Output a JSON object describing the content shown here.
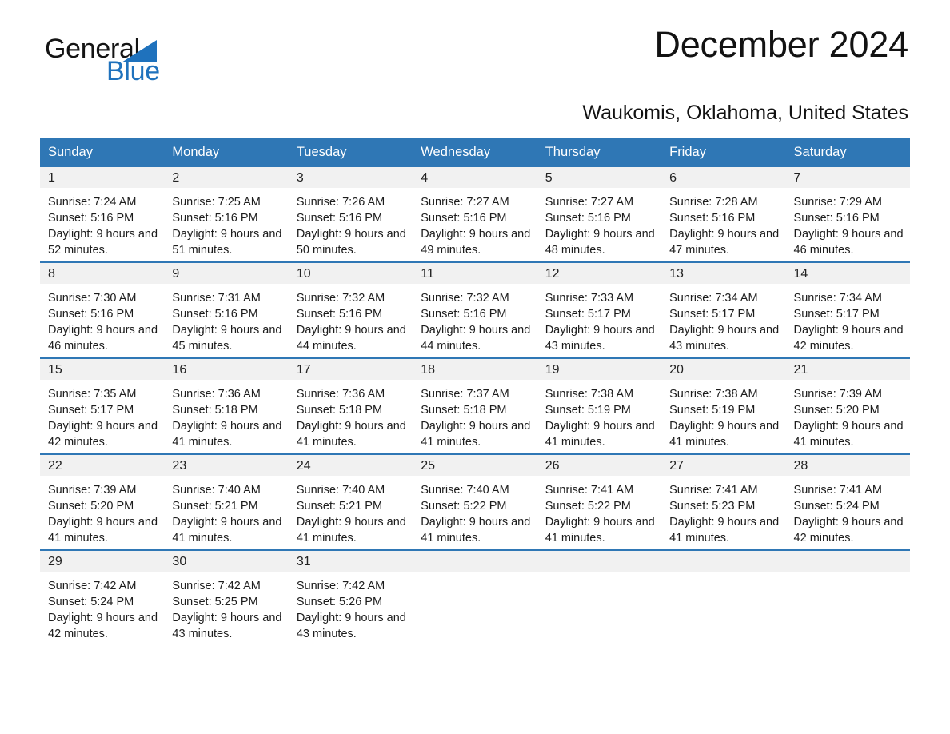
{
  "brand": {
    "word1": "General",
    "word2": "Blue",
    "triangle_color": "#1f72bd",
    "text_color": "#141414"
  },
  "header": {
    "month_title": "December 2024",
    "location": "Waukomis, Oklahoma, United States",
    "header_bg": "#2f77b5",
    "header_text_color": "#ffffff"
  },
  "weekday_headers": [
    "Sunday",
    "Monday",
    "Tuesday",
    "Wednesday",
    "Thursday",
    "Friday",
    "Saturday"
  ],
  "labels": {
    "sunrise_prefix": "Sunrise:",
    "sunset_prefix": "Sunset:",
    "daylight_prefix": "Daylight:"
  },
  "weeks": [
    [
      {
        "day": "1",
        "sunrise": "Sunrise: 7:24 AM",
        "sunset": "Sunset: 5:16 PM",
        "daylight": "Daylight: 9 hours and 52 minutes."
      },
      {
        "day": "2",
        "sunrise": "Sunrise: 7:25 AM",
        "sunset": "Sunset: 5:16 PM",
        "daylight": "Daylight: 9 hours and 51 minutes."
      },
      {
        "day": "3",
        "sunrise": "Sunrise: 7:26 AM",
        "sunset": "Sunset: 5:16 PM",
        "daylight": "Daylight: 9 hours and 50 minutes."
      },
      {
        "day": "4",
        "sunrise": "Sunrise: 7:27 AM",
        "sunset": "Sunset: 5:16 PM",
        "daylight": "Daylight: 9 hours and 49 minutes."
      },
      {
        "day": "5",
        "sunrise": "Sunrise: 7:27 AM",
        "sunset": "Sunset: 5:16 PM",
        "daylight": "Daylight: 9 hours and 48 minutes."
      },
      {
        "day": "6",
        "sunrise": "Sunrise: 7:28 AM",
        "sunset": "Sunset: 5:16 PM",
        "daylight": "Daylight: 9 hours and 47 minutes."
      },
      {
        "day": "7",
        "sunrise": "Sunrise: 7:29 AM",
        "sunset": "Sunset: 5:16 PM",
        "daylight": "Daylight: 9 hours and 46 minutes."
      }
    ],
    [
      {
        "day": "8",
        "sunrise": "Sunrise: 7:30 AM",
        "sunset": "Sunset: 5:16 PM",
        "daylight": "Daylight: 9 hours and 46 minutes."
      },
      {
        "day": "9",
        "sunrise": "Sunrise: 7:31 AM",
        "sunset": "Sunset: 5:16 PM",
        "daylight": "Daylight: 9 hours and 45 minutes."
      },
      {
        "day": "10",
        "sunrise": "Sunrise: 7:32 AM",
        "sunset": "Sunset: 5:16 PM",
        "daylight": "Daylight: 9 hours and 44 minutes."
      },
      {
        "day": "11",
        "sunrise": "Sunrise: 7:32 AM",
        "sunset": "Sunset: 5:16 PM",
        "daylight": "Daylight: 9 hours and 44 minutes."
      },
      {
        "day": "12",
        "sunrise": "Sunrise: 7:33 AM",
        "sunset": "Sunset: 5:17 PM",
        "daylight": "Daylight: 9 hours and 43 minutes."
      },
      {
        "day": "13",
        "sunrise": "Sunrise: 7:34 AM",
        "sunset": "Sunset: 5:17 PM",
        "daylight": "Daylight: 9 hours and 43 minutes."
      },
      {
        "day": "14",
        "sunrise": "Sunrise: 7:34 AM",
        "sunset": "Sunset: 5:17 PM",
        "daylight": "Daylight: 9 hours and 42 minutes."
      }
    ],
    [
      {
        "day": "15",
        "sunrise": "Sunrise: 7:35 AM",
        "sunset": "Sunset: 5:17 PM",
        "daylight": "Daylight: 9 hours and 42 minutes."
      },
      {
        "day": "16",
        "sunrise": "Sunrise: 7:36 AM",
        "sunset": "Sunset: 5:18 PM",
        "daylight": "Daylight: 9 hours and 41 minutes."
      },
      {
        "day": "17",
        "sunrise": "Sunrise: 7:36 AM",
        "sunset": "Sunset: 5:18 PM",
        "daylight": "Daylight: 9 hours and 41 minutes."
      },
      {
        "day": "18",
        "sunrise": "Sunrise: 7:37 AM",
        "sunset": "Sunset: 5:18 PM",
        "daylight": "Daylight: 9 hours and 41 minutes."
      },
      {
        "day": "19",
        "sunrise": "Sunrise: 7:38 AM",
        "sunset": "Sunset: 5:19 PM",
        "daylight": "Daylight: 9 hours and 41 minutes."
      },
      {
        "day": "20",
        "sunrise": "Sunrise: 7:38 AM",
        "sunset": "Sunset: 5:19 PM",
        "daylight": "Daylight: 9 hours and 41 minutes."
      },
      {
        "day": "21",
        "sunrise": "Sunrise: 7:39 AM",
        "sunset": "Sunset: 5:20 PM",
        "daylight": "Daylight: 9 hours and 41 minutes."
      }
    ],
    [
      {
        "day": "22",
        "sunrise": "Sunrise: 7:39 AM",
        "sunset": "Sunset: 5:20 PM",
        "daylight": "Daylight: 9 hours and 41 minutes."
      },
      {
        "day": "23",
        "sunrise": "Sunrise: 7:40 AM",
        "sunset": "Sunset: 5:21 PM",
        "daylight": "Daylight: 9 hours and 41 minutes."
      },
      {
        "day": "24",
        "sunrise": "Sunrise: 7:40 AM",
        "sunset": "Sunset: 5:21 PM",
        "daylight": "Daylight: 9 hours and 41 minutes."
      },
      {
        "day": "25",
        "sunrise": "Sunrise: 7:40 AM",
        "sunset": "Sunset: 5:22 PM",
        "daylight": "Daylight: 9 hours and 41 minutes."
      },
      {
        "day": "26",
        "sunrise": "Sunrise: 7:41 AM",
        "sunset": "Sunset: 5:22 PM",
        "daylight": "Daylight: 9 hours and 41 minutes."
      },
      {
        "day": "27",
        "sunrise": "Sunrise: 7:41 AM",
        "sunset": "Sunset: 5:23 PM",
        "daylight": "Daylight: 9 hours and 41 minutes."
      },
      {
        "day": "28",
        "sunrise": "Sunrise: 7:41 AM",
        "sunset": "Sunset: 5:24 PM",
        "daylight": "Daylight: 9 hours and 42 minutes."
      }
    ],
    [
      {
        "day": "29",
        "sunrise": "Sunrise: 7:42 AM",
        "sunset": "Sunset: 5:24 PM",
        "daylight": "Daylight: 9 hours and 42 minutes."
      },
      {
        "day": "30",
        "sunrise": "Sunrise: 7:42 AM",
        "sunset": "Sunset: 5:25 PM",
        "daylight": "Daylight: 9 hours and 43 minutes."
      },
      {
        "day": "31",
        "sunrise": "Sunrise: 7:42 AM",
        "sunset": "Sunset: 5:26 PM",
        "daylight": "Daylight: 9 hours and 43 minutes."
      },
      {
        "day": "",
        "sunrise": "",
        "sunset": "",
        "daylight": ""
      },
      {
        "day": "",
        "sunrise": "",
        "sunset": "",
        "daylight": ""
      },
      {
        "day": "",
        "sunrise": "",
        "sunset": "",
        "daylight": ""
      },
      {
        "day": "",
        "sunrise": "",
        "sunset": "",
        "daylight": ""
      }
    ]
  ]
}
